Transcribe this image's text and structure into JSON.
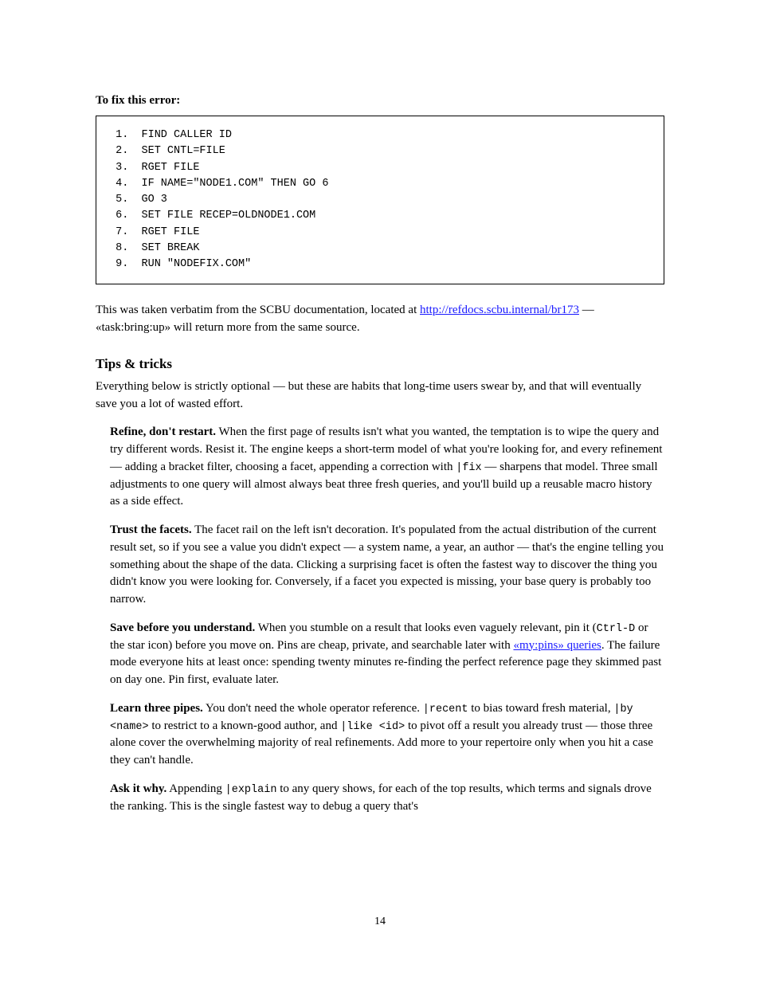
{
  "heading_fix": "To fix this error:",
  "code": {
    "l1": " 1.  FIND CALLER ID",
    "l2": " 2.  SET CNTL=FILE",
    "l3": " 3.  RGET FILE",
    "l4": " 4.  IF NAME=\"NODE1.COM\" THEN GO 6",
    "l5": " 5.  GO 3",
    "l6": " 6.  SET FILE RECEP=OLDNODE1.COM",
    "l7": " 7.  RGET FILE",
    "l8": " 8.  SET BREAK",
    "l9": " 9.  RUN \"NODEFIX.COM\""
  },
  "intro_resources": {
    "pre": "This was taken verbatim from the SCBU documentation, located at ",
    "link_text": "http://refdocs.scbu.internal/br173",
    "post": " — «task:bring:up» will return more from the same source."
  },
  "tips_title": "Tips & tricks",
  "tips_p1": "Everything below is strictly optional — but these are habits that long-time users swear by, and that will eventually save you a lot of wasted effort.",
  "tip_refine_title": "Refine, don't restart.",
  "tip_refine_body_1": " When the first page of results isn't what you wanted, the temptation is to wipe the query and try different words. Resist it. The engine keeps a short-term model of what you're looking for, and every refinement — adding a bracket filter, choosing a facet, appending a correction with ",
  "tip_refine_mono": "|fix",
  "tip_refine_body_2": " — sharpens that model. Three small adjustments to one query will almost always beat three fresh queries, and you'll build up a reusable macro history as a side effect.",
  "tip_trust_title": "Trust the facets.",
  "tip_trust_body": " The facet rail on the left isn't decoration. It's populated from the actual distribution of the current result set, so if you see a value you didn't expect — a system name, a year, an author — that's the engine telling you something about the shape of the data. Clicking a surprising facet is often the fastest way to discover the thing you didn't know you were looking for. Conversely, if a facet you expected is missing, your base query is probably too narrow.",
  "tip_save_title": "Save before you understand.",
  "tip_save_body_1": " When you stumble on a result that looks even vaguely relevant, pin it (",
  "tip_save_mono": "Ctrl-D",
  "tip_save_body_2": " or the star icon) before you move on. Pins are cheap, private, and searchable later with ",
  "tip_save_link": "«my:pins» queries",
  "tip_save_body_3": ". The failure mode everyone hits at least once: spending twenty minutes re-finding the perfect reference page they skimmed past on day one. Pin first, evaluate later.",
  "tip_pipes_title": "Learn three pipes.",
  "tip_pipes_body_1": " You don't need the whole operator reference. ",
  "tip_pipes_m1": "|recent",
  "tip_pipes_body_2": " to bias toward fresh material, ",
  "tip_pipes_m2": "|by <name>",
  "tip_pipes_body_3": " to restrict to a known-good author, and ",
  "tip_pipes_m3": "|like <id>",
  "tip_pipes_body_4": " to pivot off a result you already trust — those three alone cover the overwhelming majority of real refinements. Add more to your repertoire only when you hit a case they can't handle.",
  "tip_ask_title": "Ask it why.",
  "tip_ask_body_1": " Appending ",
  "tip_ask_m1": "|explain",
  "tip_ask_body_2": " to any query shows, for each of the top results, which terms and signals drove the ranking. This is the single fastest way to debug a query that's",
  "page_number": "14"
}
